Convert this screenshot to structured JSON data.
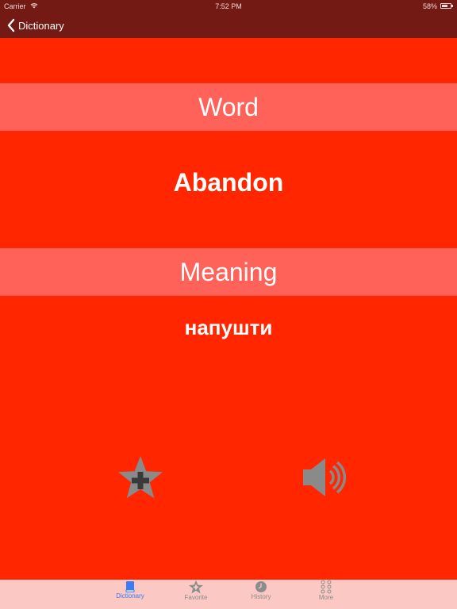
{
  "status_bar": {
    "carrier": "Carrier",
    "time": "7:52 PM",
    "battery": "58%"
  },
  "nav": {
    "back_label": "Dictionary"
  },
  "word_section": {
    "header": "Word",
    "value": "Abandon"
  },
  "meaning_section": {
    "header": "Meaning",
    "value": "напушти"
  },
  "actions": {
    "favorite_icon": "star-plus-icon",
    "sound_icon": "speaker-icon"
  },
  "tab_bar": {
    "selected": "Dictionary",
    "tabs": [
      {
        "label": "Dictionary",
        "icon": "book-icon"
      },
      {
        "label": "Favorite",
        "icon": "star-icon"
      },
      {
        "label": "History",
        "icon": "clock-icon"
      },
      {
        "label": "More",
        "icon": "more-dots-icon"
      }
    ]
  },
  "colors": {
    "background": "#ff2600",
    "header_band": "#ff6259",
    "nav_bar": "#741a14",
    "tab_bar": "#fbc8c3",
    "tab_active": "#3a7cf5",
    "tab_inactive": "#8c8c8c"
  }
}
